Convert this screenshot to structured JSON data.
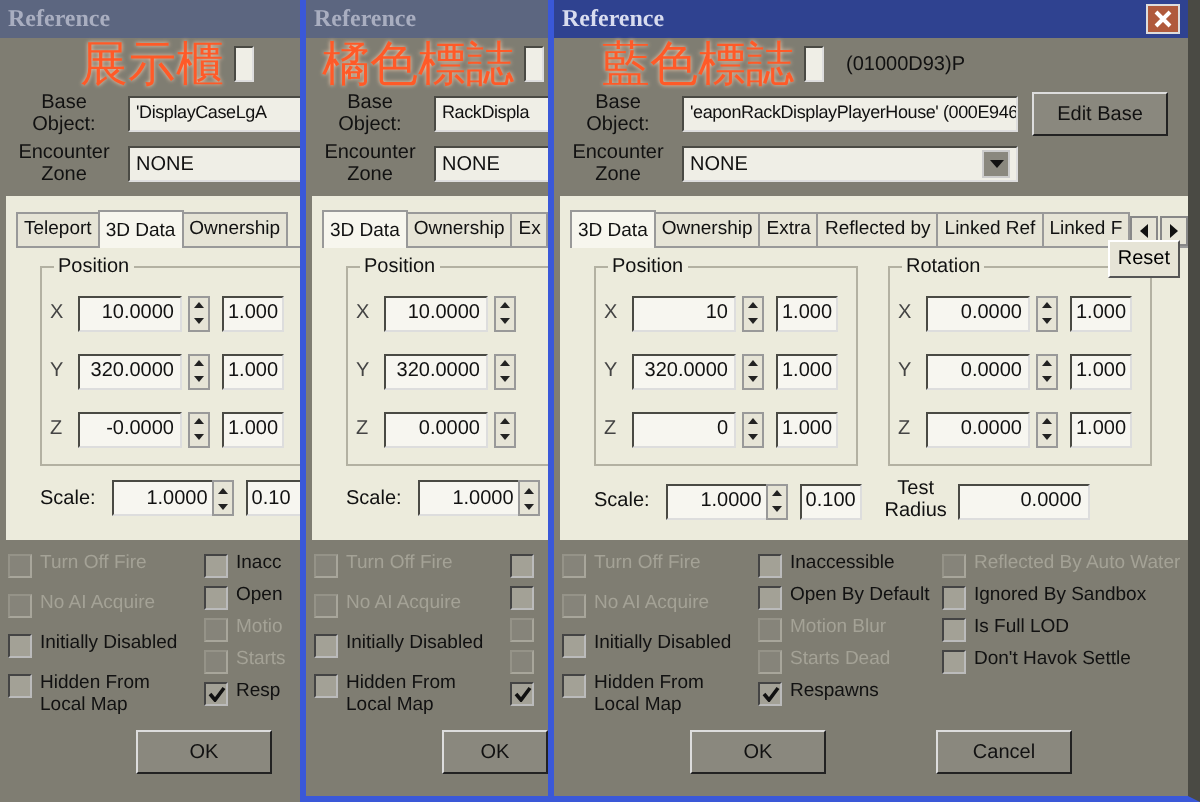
{
  "panels": [
    {
      "title": "Reference",
      "active": false,
      "highlighted": false,
      "caption": "展示櫃",
      "base_label": "Base Object:",
      "encounter_label": "Encounter Zone",
      "base_object": "'DisplayCaseLgA",
      "encounter_zone": {
        "value": "NONE"
      },
      "tabs": [
        {
          "label": "Teleport",
          "selected": false
        },
        {
          "label": "3D Data",
          "selected": true
        },
        {
          "label": "Ownership",
          "selected": false
        }
      ],
      "groups": [
        {
          "title": "Position",
          "rows": [
            {
              "axis": "X",
              "value": "10.0000",
              "step": "1.000"
            },
            {
              "axis": "Y",
              "value": "320.0000",
              "step": "1.000"
            },
            {
              "axis": "Z",
              "value": "-0.0000",
              "step": "1.000"
            }
          ]
        }
      ],
      "scale": {
        "label": "Scale:",
        "value": "1.0000",
        "step": "0.10"
      },
      "checkbox_columns": [
        [
          {
            "label": "Turn Off Fire",
            "checked": false,
            "disabled": true
          },
          {
            "label": "No AI Acquire",
            "checked": false,
            "disabled": true
          },
          {
            "label": "Initially Disabled",
            "checked": false,
            "disabled": false
          },
          {
            "label": "Hidden From Local Map",
            "checked": false,
            "disabled": false
          }
        ],
        [
          {
            "label": "Inacc",
            "checked": false,
            "disabled": false
          },
          {
            "label": "Open",
            "checked": false,
            "disabled": false
          },
          {
            "label": "Motio",
            "checked": false,
            "disabled": true
          },
          {
            "label": "Starts",
            "checked": false,
            "disabled": true
          },
          {
            "label": "Resp",
            "checked": true,
            "disabled": false
          }
        ]
      ],
      "buttons": [
        "OK"
      ]
    },
    {
      "title": "Reference",
      "active": false,
      "highlighted": true,
      "caption": "橘色標誌",
      "base_label": "Base Object:",
      "encounter_label": "Encounter Zone",
      "base_object": "RackDispla",
      "encounter_zone": {
        "value": "NONE"
      },
      "tabs": [
        {
          "label": "3D Data",
          "selected": true
        },
        {
          "label": "Ownership",
          "selected": false
        },
        {
          "label": "Ex",
          "selected": false
        }
      ],
      "groups": [
        {
          "title": "Position",
          "rows": [
            {
              "axis": "X",
              "value": "10.0000"
            },
            {
              "axis": "Y",
              "value": "320.0000"
            },
            {
              "axis": "Z",
              "value": "0.0000"
            }
          ]
        }
      ],
      "scale": {
        "label": "Scale:",
        "value": "1.0000"
      },
      "checkbox_columns": [
        [
          {
            "label": "Turn Off Fire",
            "checked": false,
            "disabled": true
          },
          {
            "label": "No AI Acquire",
            "checked": false,
            "disabled": true
          },
          {
            "label": "Initially Disabled",
            "checked": false,
            "disabled": false
          },
          {
            "label": "Hidden From Local Map",
            "checked": false,
            "disabled": false
          }
        ],
        [
          {
            "checked": false,
            "disabled": false
          },
          {
            "checked": false,
            "disabled": false
          },
          {
            "checked": false,
            "disabled": true
          },
          {
            "checked": false,
            "disabled": true
          },
          {
            "checked": true,
            "disabled": false
          }
        ]
      ],
      "buttons": [
        "OK"
      ]
    },
    {
      "title": "Reference",
      "active": true,
      "highlighted": true,
      "caption": "藍色標誌",
      "base_label": "Base Object:",
      "encounter_label": "Encounter Zone",
      "editor_id_suffix": "(01000D93)P",
      "base_object": "'eaponRackDisplayPlayerHouse' (000E946",
      "edit_base": "Edit Base",
      "encounter_zone": {
        "value": "NONE",
        "arrow": true
      },
      "tabs": [
        {
          "label": "3D Data",
          "selected": true
        },
        {
          "label": "Ownership",
          "selected": false
        },
        {
          "label": "Extra",
          "selected": false
        },
        {
          "label": "Reflected by",
          "selected": false
        },
        {
          "label": "Linked Ref",
          "selected": false
        },
        {
          "label": "Linked F",
          "selected": false
        }
      ],
      "tab_scroll": true,
      "groups": [
        {
          "title": "Position",
          "rows": [
            {
              "axis": "X",
              "value": "10",
              "step": "1.000"
            },
            {
              "axis": "Y",
              "value": "320.0000",
              "step": "1.000"
            },
            {
              "axis": "Z",
              "value": "0",
              "step": "1.000"
            }
          ]
        },
        {
          "title": "Rotation",
          "rows": [
            {
              "axis": "X",
              "value": "0.0000",
              "step": "1.000"
            },
            {
              "axis": "Y",
              "value": "0.0000",
              "step": "1.000"
            },
            {
              "axis": "Z",
              "value": "0.0000",
              "step": "1.000"
            }
          ]
        }
      ],
      "reset": "Reset",
      "scale": {
        "label": "Scale:",
        "value": "1.0000",
        "step": "0.100"
      },
      "test_radius": {
        "label": "Test Radius",
        "value": "0.0000"
      },
      "checkbox_columns": [
        [
          {
            "label": "Turn Off Fire",
            "checked": false,
            "disabled": true
          },
          {
            "label": "No AI Acquire",
            "checked": false,
            "disabled": true
          },
          {
            "label": "Initially Disabled",
            "checked": false,
            "disabled": false
          },
          {
            "label": "Hidden From Local Map",
            "checked": false,
            "disabled": false
          }
        ],
        [
          {
            "label": "Inaccessible",
            "checked": false,
            "disabled": false
          },
          {
            "label": "Open By Default",
            "checked": false,
            "disabled": false
          },
          {
            "label": "Motion Blur",
            "checked": false,
            "disabled": true
          },
          {
            "label": "Starts Dead",
            "checked": false,
            "disabled": true
          },
          {
            "label": "Respawns",
            "checked": true,
            "disabled": false
          }
        ],
        [
          {
            "label": "Reflected By Auto Water",
            "checked": false,
            "disabled": true
          },
          {
            "label": "Ignored By Sandbox",
            "checked": false,
            "disabled": false
          },
          {
            "label": "Is Full LOD",
            "checked": false,
            "disabled": false
          },
          {
            "label": "Don't Havok Settle",
            "checked": false,
            "disabled": false
          }
        ]
      ],
      "buttons": [
        "OK",
        "Cancel"
      ]
    }
  ]
}
